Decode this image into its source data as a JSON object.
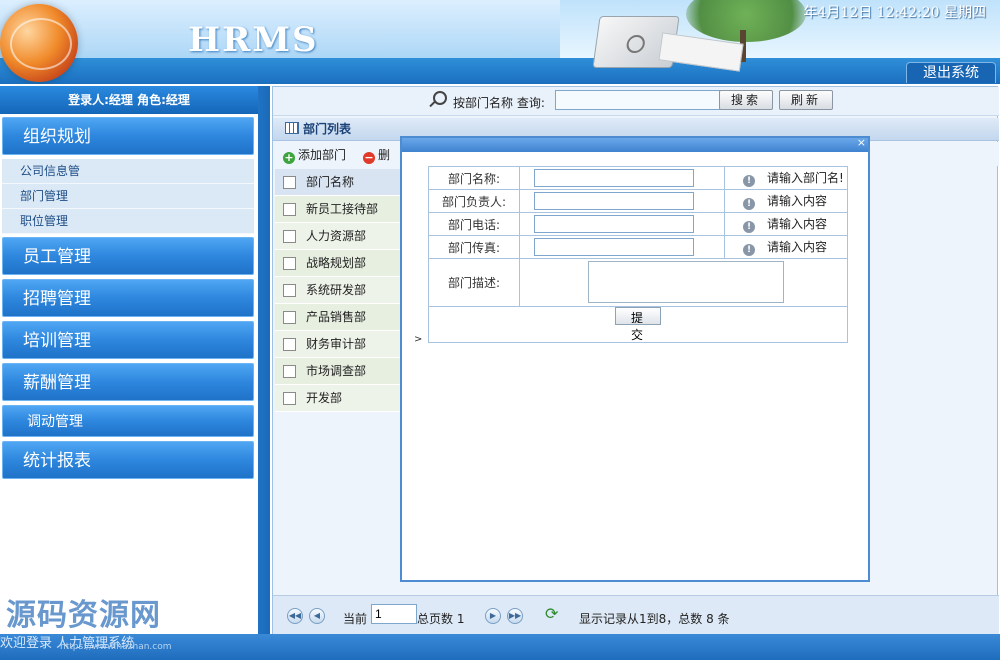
{
  "header": {
    "brand": "HRMS",
    "datetime": "年4月12日 12:42:20 星期四",
    "logout_label": "退出系统"
  },
  "sidebar": {
    "user_info": "登录人:经理 角色:经理",
    "groups": [
      {
        "label": "组织规划",
        "subitems": [
          "公司信息管",
          "部门管理",
          "职位管理"
        ]
      },
      {
        "label": "员工管理"
      },
      {
        "label": "招聘管理"
      },
      {
        "label": "培训管理"
      },
      {
        "label": "薪酬管理"
      },
      {
        "label": "调动管理"
      },
      {
        "label": "统计报表"
      }
    ]
  },
  "watermark": "源码资源网",
  "search": {
    "label": "按部门名称 查询:",
    "value": "",
    "search_button": "搜索",
    "refresh_button": "刷新"
  },
  "panel": {
    "title": "部门列表",
    "add_label": "添加部门",
    "delete_label": "删"
  },
  "table": {
    "header": "部门名称",
    "rows": [
      "新员工接待部",
      "人力资源部",
      "战略规划部",
      "系统研发部",
      "产品销售部",
      "财务审计部",
      "市场调查部",
      "开发部"
    ]
  },
  "modal": {
    "close": "×",
    "fields": [
      {
        "label": "部门名称:",
        "value": "",
        "hint": "请输入部门名!"
      },
      {
        "label": "部门负责人:",
        "value": "",
        "hint": "请输入内容"
      },
      {
        "label": "部门电话:",
        "value": "",
        "hint": "请输入内容"
      },
      {
        "label": "部门传真:",
        "value": "",
        "hint": "请输入内容"
      }
    ],
    "desc_label": "部门描述:",
    "submit_label": "提 交",
    "arrow": ">"
  },
  "pager": {
    "current_label": "当前",
    "current_value": "1",
    "total_pages_label": "总页数 1",
    "status": "显示记录从1到8，总数 8 条"
  },
  "footer": {
    "text": "欢迎登录   人力管理系统",
    "url": "https://www.huzhan.com"
  },
  "colors": {
    "accent": "#2e87de",
    "header_band": "#1a6fbf"
  }
}
